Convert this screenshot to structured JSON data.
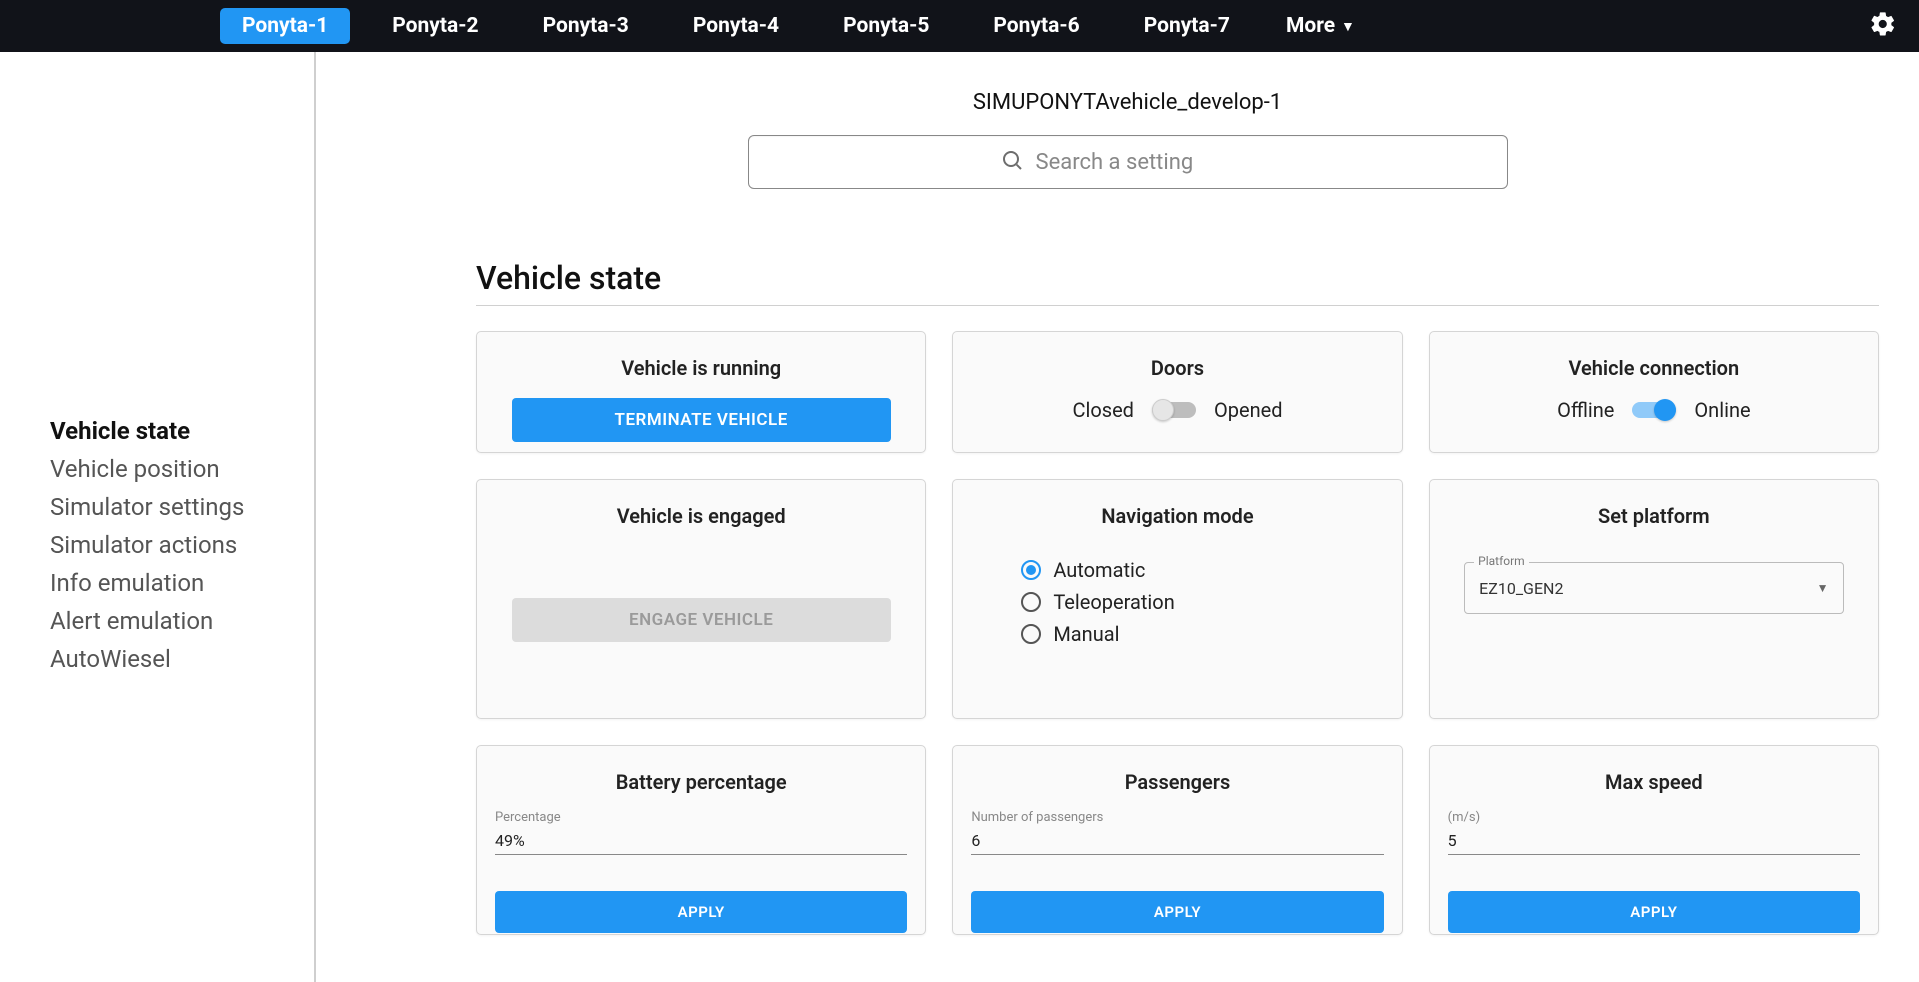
{
  "topbar": {
    "tabs": [
      "Ponyta-1",
      "Ponyta-2",
      "Ponyta-3",
      "Ponyta-4",
      "Ponyta-5",
      "Ponyta-6",
      "Ponyta-7"
    ],
    "more_label": "More"
  },
  "page_title": "SIMUPONYTAvehicle_develop-1",
  "search": {
    "placeholder": "Search a setting"
  },
  "sidebar": {
    "items": [
      "Vehicle state",
      "Vehicle position",
      "Simulator settings",
      "Simulator actions",
      "Info emulation",
      "Alert emulation",
      "AutoWiesel"
    ]
  },
  "section": {
    "title": "Vehicle state"
  },
  "cards": {
    "running": {
      "title": "Vehicle is running",
      "button": "TERMINATE VEHICLE"
    },
    "doors": {
      "title": "Doors",
      "left": "Closed",
      "right": "Opened"
    },
    "connection": {
      "title": "Vehicle connection",
      "left": "Offline",
      "right": "Online"
    },
    "engaged": {
      "title": "Vehicle is engaged",
      "button": "ENGAGE VEHICLE"
    },
    "nav": {
      "title": "Navigation mode",
      "options": [
        "Automatic",
        "Teleoperation",
        "Manual"
      ]
    },
    "platform": {
      "title": "Set platform",
      "legend": "Platform",
      "value": "EZ10_GEN2"
    },
    "battery": {
      "title": "Battery percentage",
      "field_label": "Percentage",
      "value": "49%",
      "apply": "APPLY"
    },
    "passengers": {
      "title": "Passengers",
      "field_label": "Number of passengers",
      "value": "6",
      "apply": "APPLY"
    },
    "maxspeed": {
      "title": "Max speed",
      "field_label": "(m/s)",
      "value": "5",
      "apply": "APPLY"
    }
  }
}
